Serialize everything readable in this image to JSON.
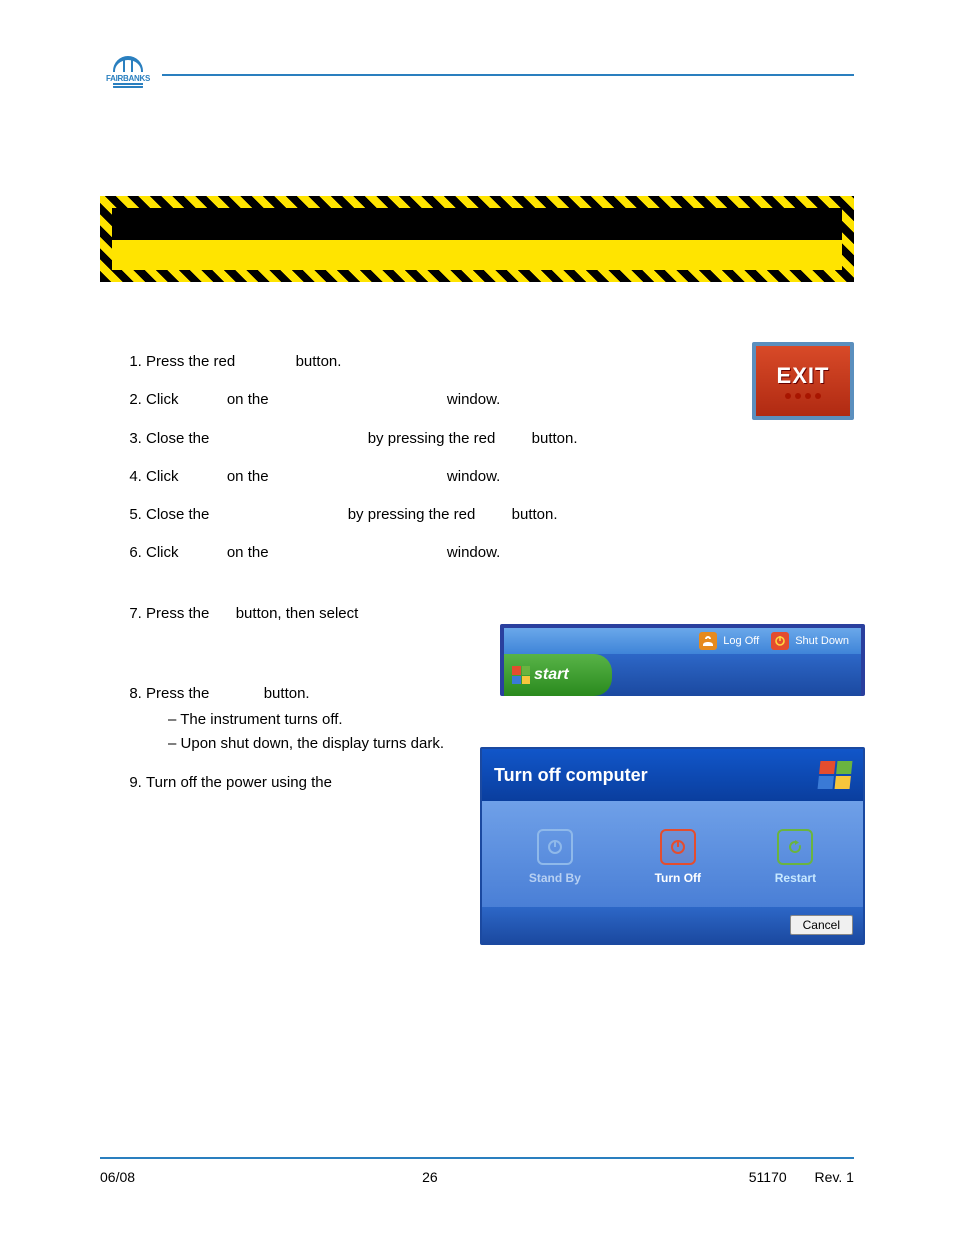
{
  "logo": {
    "name": "FAIRBANKS"
  },
  "exit_badge": {
    "label": "EXIT"
  },
  "steps": {
    "s1a": "Press the red",
    "s1b": "button.",
    "s2a": "Click",
    "s2b": "on the",
    "s2c": "window.",
    "s3a": "Close the",
    "s3b": "by pressing the red",
    "s3c": "button.",
    "s4a": "Click",
    "s4b": "on the",
    "s4c": "window.",
    "s5a": "Close the",
    "s5b": "by pressing the red",
    "s5c": "button.",
    "s6a": "Click",
    "s6b": "on the",
    "s6c": "window.",
    "s7a": "Press the",
    "s7b": "button, then select",
    "s8a": "Press the",
    "s8b": "button.",
    "s8_sub1": "The instrument turns off.",
    "s8_sub2": "Upon shut down, the display turns dark.",
    "s9": "Turn off the power using the"
  },
  "start_strip": {
    "logoff": "Log Off",
    "shutdown": "Shut Down",
    "start": "start"
  },
  "turnoff": {
    "title": "Turn off computer",
    "standby": "Stand By",
    "turnoff": "Turn Off",
    "restart": "Restart",
    "cancel": "Cancel"
  },
  "footer": {
    "left": "06/08",
    "center": "26",
    "doc": "51170",
    "rev": "Rev. 1"
  }
}
